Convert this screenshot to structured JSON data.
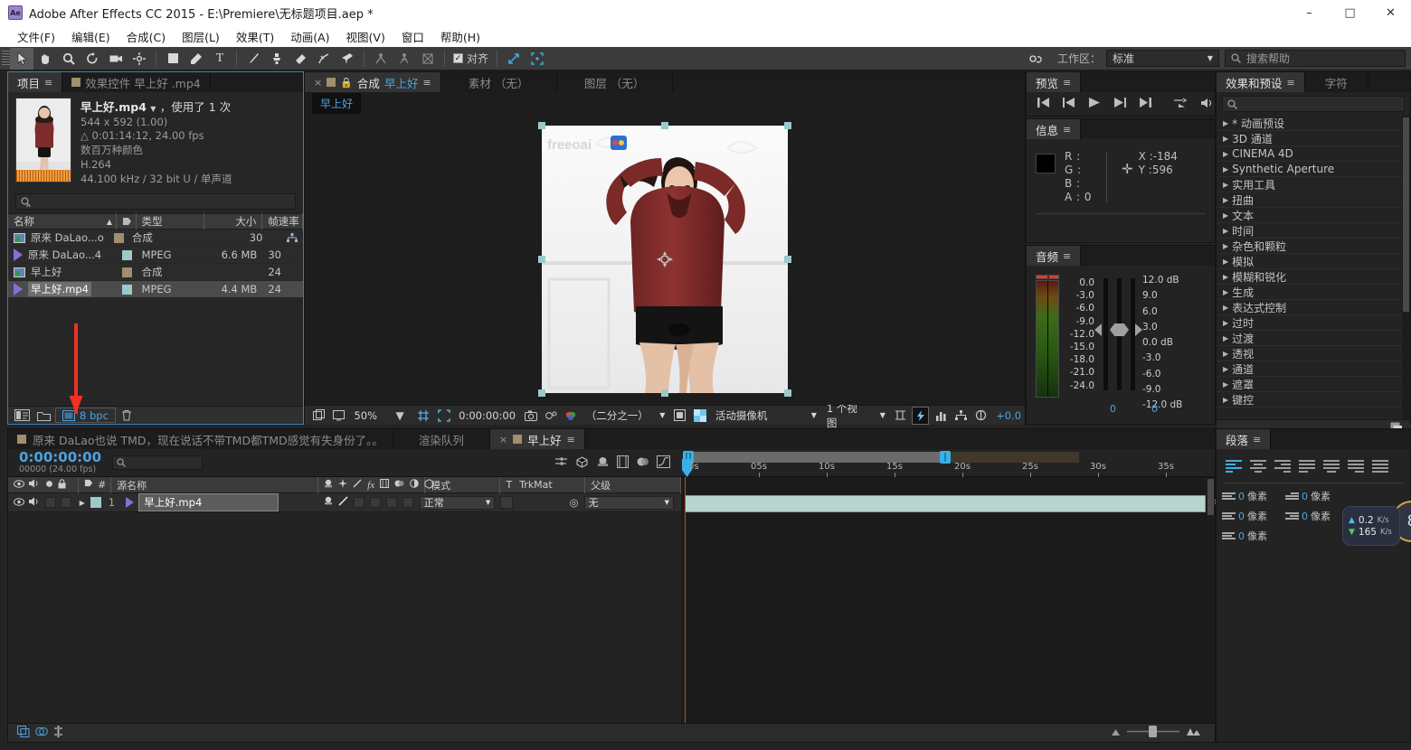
{
  "window": {
    "app_icon": "ae-logo",
    "title": "Adobe After Effects CC 2015 - E:\\Premiere\\无标题项目.aep *",
    "minimize": "–",
    "maximize": "□",
    "close": "✕"
  },
  "menubar": {
    "items": [
      "文件(F)",
      "编辑(E)",
      "合成(C)",
      "图层(L)",
      "效果(T)",
      "动画(A)",
      "视图(V)",
      "窗口",
      "帮助(H)"
    ]
  },
  "toolbar": {
    "snap_label": "对齐",
    "snap_checked": "✓",
    "workspace_label": "工作区：",
    "workspace_value": "标准",
    "help_placeholder": "搜索帮助",
    "icons": [
      "selection-tool",
      "hand-tool",
      "zoom-tool",
      "rotate-tool",
      "camera-tool",
      "pan-behind-tool",
      "shape-tool",
      "pen-tool",
      "text-tool",
      "brush-tool",
      "clone-stamp-tool",
      "eraser-tool",
      "roto-brush-tool",
      "puppet-pin-tool",
      "puppet-overlap-tool",
      "puppet-starch-tool",
      "puppet-mesh-tool"
    ]
  },
  "project": {
    "tabs": [
      {
        "label": "项目",
        "active": true
      },
      {
        "label": "效果控件 早上好 .mp4",
        "active": false
      }
    ],
    "item_title": "早上好.mp4",
    "item_usage": "，使用了 1 次",
    "meta": [
      "544 x 592 (1.00)",
      "△ 0:01:14:12, 24.00 fps",
      "数百万种颜色",
      "H.264",
      "44.100 kHz / 32 bit U / 单声道"
    ],
    "search_placeholder": "",
    "columns": [
      "名称",
      "类型",
      "大小",
      "帧速率"
    ],
    "rows": [
      {
        "name": "原来 DaLao...o",
        "icon": "comp-icon",
        "swatch": "#a08e6d",
        "type": "合成",
        "size": "",
        "fps": "30",
        "extra": "shy-icon",
        "selected": false
      },
      {
        "name": "原来 DaLao...4",
        "icon": "movie-icon",
        "swatch": "#9dc9c9",
        "type": "MPEG",
        "size": "6.6 MB",
        "fps": "30",
        "extra": "",
        "selected": false
      },
      {
        "name": "早上好",
        "icon": "comp-icon",
        "swatch": "#a08e6d",
        "type": "合成",
        "size": "",
        "fps": "24",
        "extra": "",
        "selected": false
      },
      {
        "name": "早上好.mp4",
        "icon": "movie-icon",
        "swatch": "#9dc9c9",
        "type": "MPEG",
        "size": "4.4 MB",
        "fps": "24",
        "extra": "",
        "selected": true
      }
    ],
    "footer_bpc": "8 bpc",
    "footer_icons": [
      "interpret-footage-icon",
      "new-folder-icon",
      "new-comp-icon",
      "delete-icon"
    ]
  },
  "composition": {
    "tabs": [
      {
        "label": "合成",
        "name": "早上好",
        "active": true
      },
      {
        "label": "素材 （无）",
        "active": false
      },
      {
        "label": "图层 （无）",
        "active": false
      }
    ],
    "breadcrumb": "早上好",
    "footer": {
      "zoom": "50%",
      "timecode": "0:00:00:00",
      "resolution": "（二分之一）",
      "camera": "活动摄像机",
      "views": "1 个视图",
      "exposure": "+0.0"
    }
  },
  "preview": {
    "tab": "预览",
    "buttons": [
      "first-frame-icon",
      "prev-frame-icon",
      "play-icon",
      "next-frame-icon",
      "last-frame-icon",
      "loop-icon",
      "audio-icon"
    ]
  },
  "info": {
    "tab": "信息",
    "channels": [
      {
        "label": "R :",
        "value": ""
      },
      {
        "label": "G :",
        "value": ""
      },
      {
        "label": "B :",
        "value": ""
      },
      {
        "label": "A :",
        "value": "0"
      }
    ],
    "x_label": "X :",
    "x_value": "-184",
    "y_label": "Y :",
    "y_value": "596"
  },
  "audio": {
    "tab": "音频",
    "vu_scale": [
      "0.0",
      "-3.0",
      "-6.0",
      "-9.0",
      "-12.0",
      "-15.0",
      "-18.0",
      "-21.0",
      "-24.0"
    ],
    "db_scale": [
      "12.0 dB",
      "9.0",
      "6.0",
      "3.0",
      "0.0 dB",
      "-3.0",
      "-6.0",
      "-9.0",
      "-12.0 dB"
    ],
    "left_value": "0",
    "right_value": "0"
  },
  "effects": {
    "tabs": [
      {
        "label": "效果和预设",
        "active": true
      },
      {
        "label": "字符",
        "active": false
      }
    ],
    "search_placeholder": "",
    "categories": [
      "* 动画预设",
      "3D 通道",
      "CINEMA 4D",
      "Synthetic Aperture",
      "实用工具",
      "扭曲",
      "文本",
      "时间",
      "杂色和颗粒",
      "模拟",
      "模糊和锐化",
      "生成",
      "表达式控制",
      "过时",
      "过渡",
      "透视",
      "通道",
      "遮罩",
      "键控"
    ]
  },
  "timeline": {
    "tabs": [
      {
        "label": "原来 DaLao也说 TMD，现在说话不带TMD都TMD感觉有失身份了。。",
        "active": false
      },
      {
        "label": "渲染队列",
        "active": false
      },
      {
        "label": "早上好",
        "active": true
      }
    ],
    "current_time": "0:00:00:00",
    "frames_label": "00000 (24.00 fps)",
    "search_placeholder": "",
    "tool_icons": [
      "composition-mini-flowchart-icon",
      "draft-3d-icon",
      "hide-shy-icon",
      "frame-blending-icon",
      "motion-blur-icon",
      "graph-editor-icon"
    ],
    "columns": [
      "源名称",
      "模式",
      "T",
      "TrkMat",
      "父级"
    ],
    "switch_icons": [
      "eye-icon",
      "audio-icon",
      "solo-icon",
      "lock-icon",
      "label-icon",
      "index-icon"
    ],
    "feature_icons": [
      "shy-icon",
      "collapse-icon",
      "quality-icon",
      "effects-icon",
      "frame-blend-icon",
      "motion-blur-icon",
      "adjustment-icon",
      "3d-layer-icon"
    ],
    "layers": [
      {
        "index": "1",
        "name": "早上好.mp4",
        "mode": "正常",
        "trkmat": "",
        "parent": "无",
        "clip_color": "#b9d4cd",
        "clip_start_pct": 0,
        "clip_width_pct": 99
      }
    ],
    "ruler_labels": [
      "0s",
      "05s",
      "10s",
      "15s",
      "20s",
      "25s",
      "30s",
      "35s"
    ],
    "work_area_end_label": ""
  },
  "paragraph": {
    "tab": "段落",
    "align_buttons": [
      "align-left",
      "align-center",
      "align-right",
      "justify-last-left",
      "justify-last-center",
      "justify-last-right",
      "justify-all"
    ],
    "indents": [
      {
        "icon": "indent-left-icon",
        "value": "0",
        "unit": "像素"
      },
      {
        "icon": "indent-first-line-icon",
        "value": "0",
        "unit": "像素"
      },
      {
        "icon": "space-before-icon",
        "value": "0",
        "unit": "像素"
      },
      {
        "icon": "indent-right-icon",
        "value": "0",
        "unit": "像素"
      },
      {
        "icon": "space-after-icon",
        "value": "0",
        "unit": "像素"
      }
    ]
  },
  "network_widget": {
    "upload": "0.2",
    "upload_unit": "K/s",
    "download": "165",
    "download_unit": "K/s"
  },
  "colors": {
    "accent_blue": "#4da3e0",
    "panel_bg": "#232323",
    "titlebar_bg": "#ffffff",
    "selection": "#3d7fb5"
  }
}
